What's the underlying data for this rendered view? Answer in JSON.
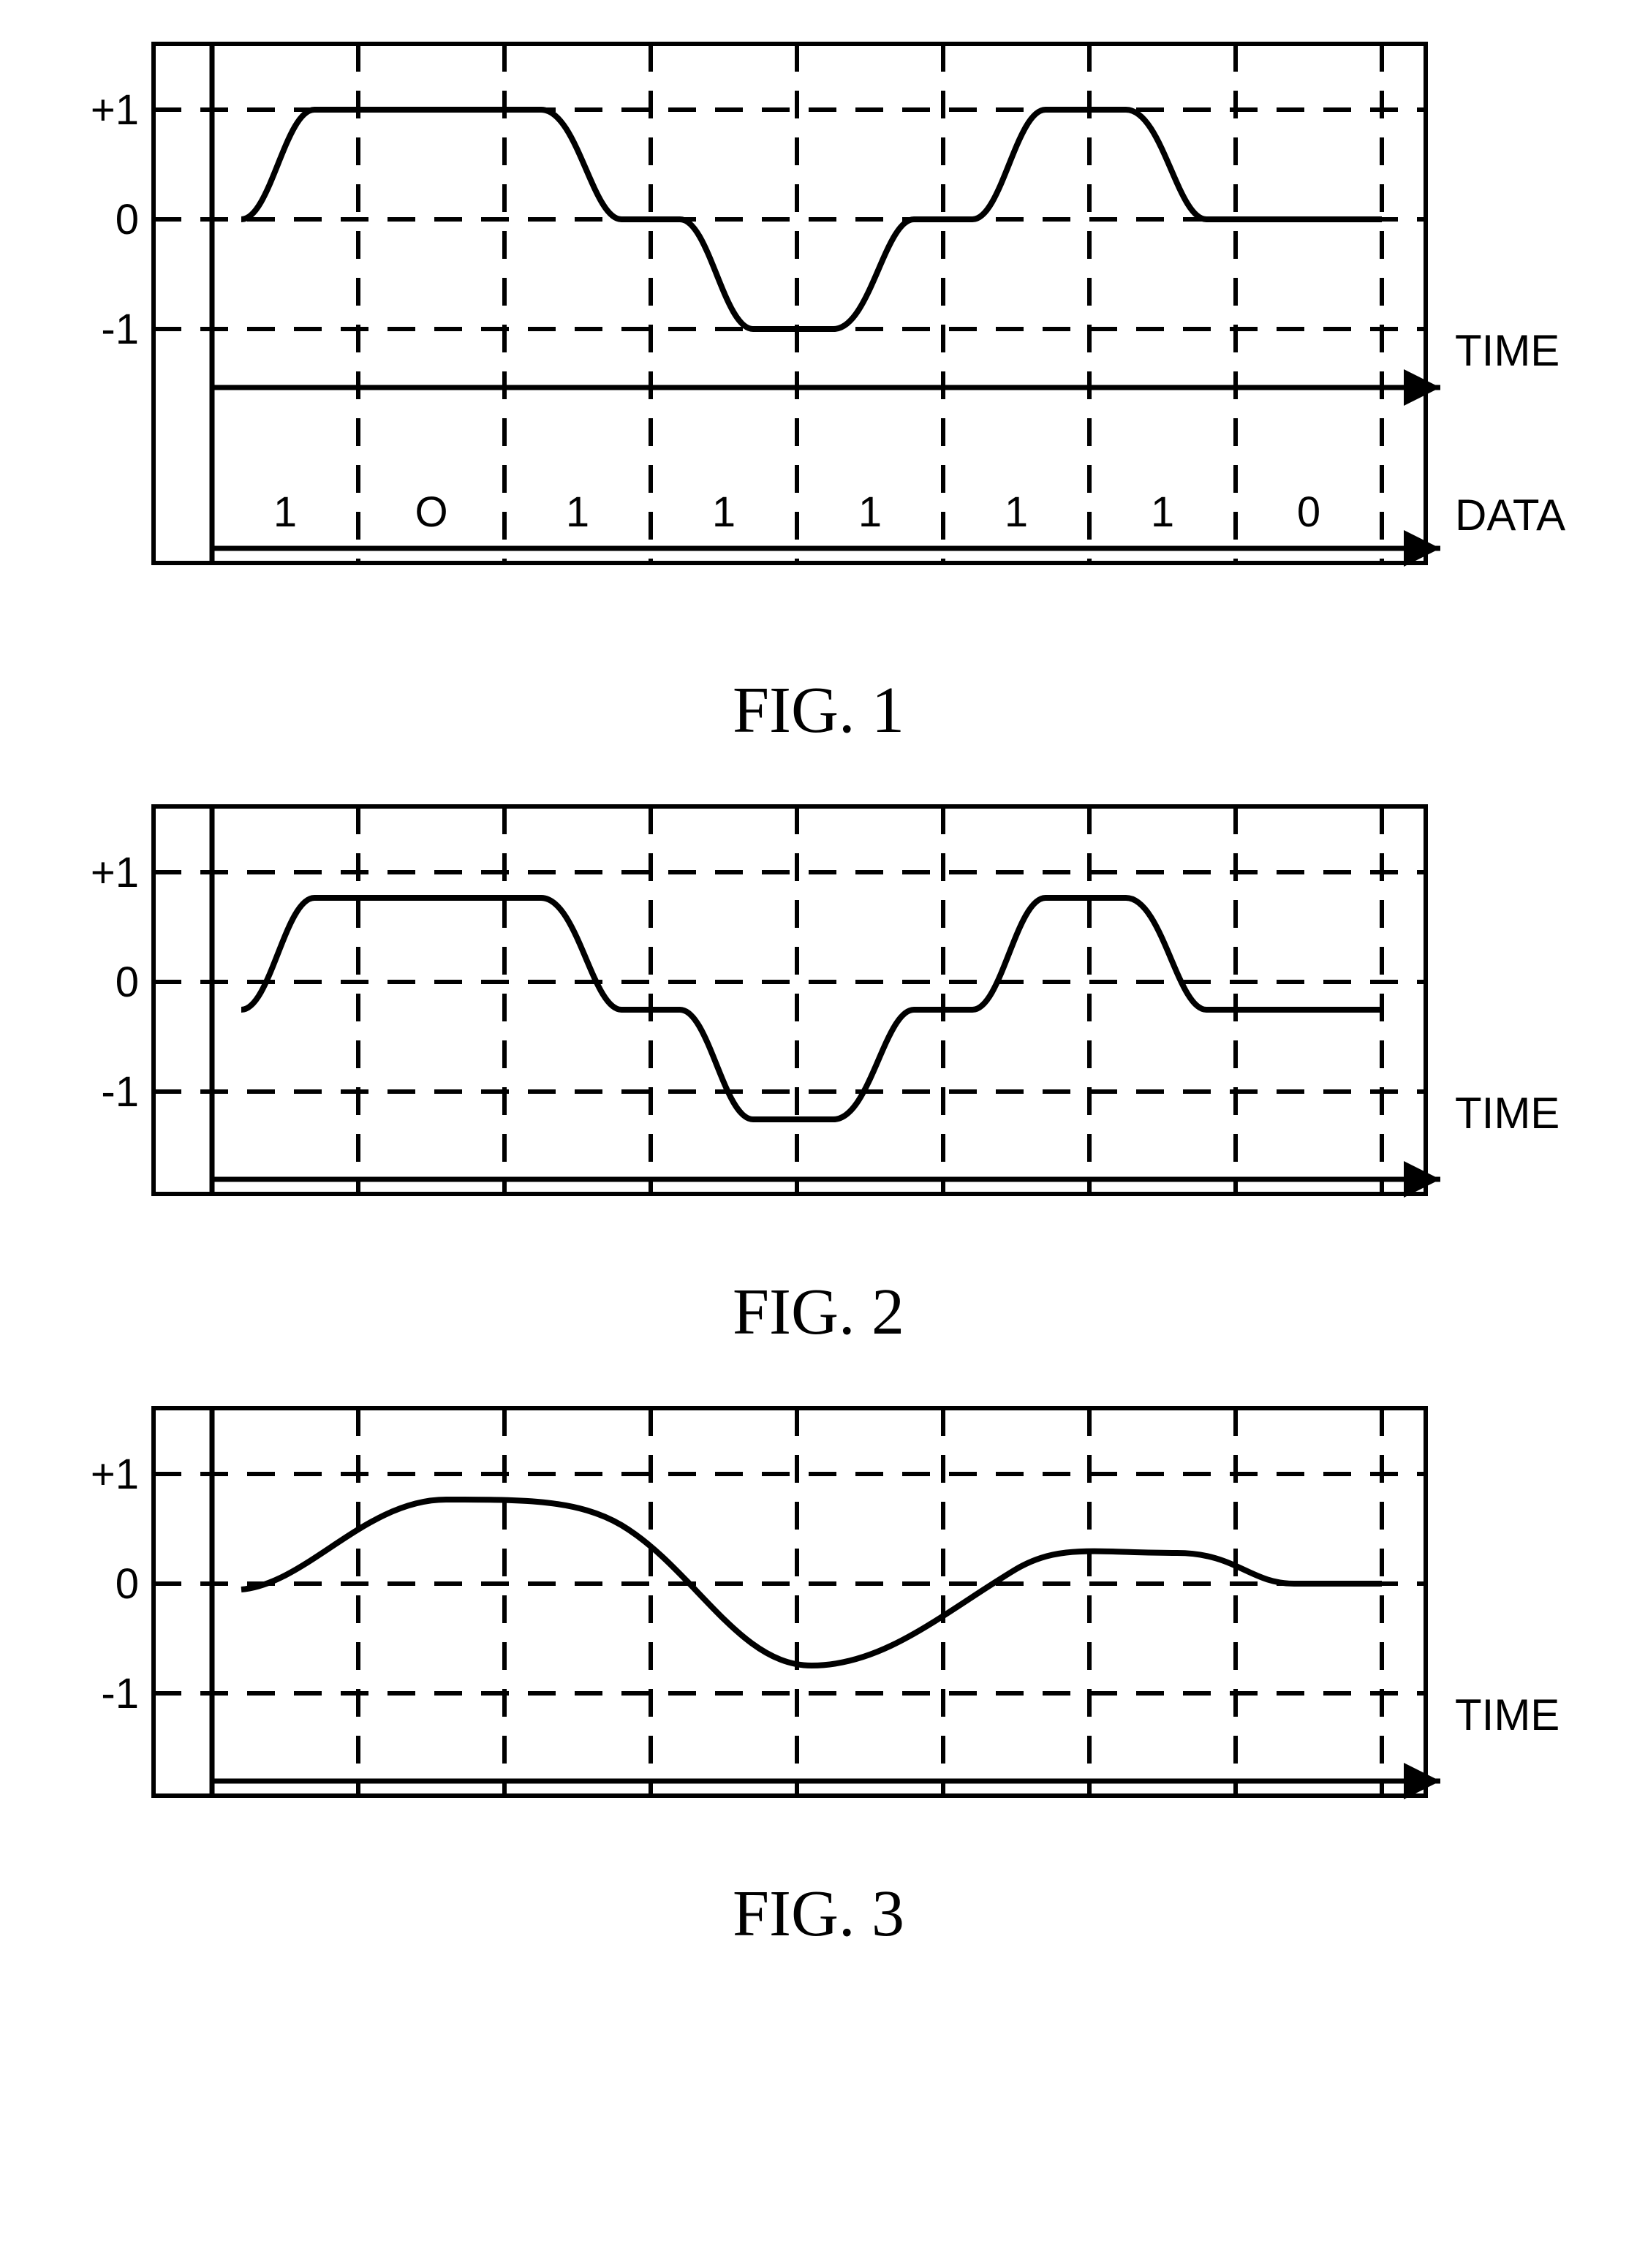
{
  "chart_data": [
    {
      "type": "line",
      "title": "FIG. 1",
      "xlabel": "TIME",
      "ylabel": "",
      "ylim": [
        -1,
        1
      ],
      "y_ticks": [
        "+1",
        "0",
        "-1"
      ],
      "x_axis2_label": "DATA",
      "data_bits": [
        "1",
        "O",
        "1",
        "1",
        "1",
        "1",
        "1",
        "0"
      ],
      "categories": [
        0,
        1,
        2,
        3,
        4,
        5,
        6,
        7,
        8
      ],
      "series": [
        {
          "name": "signal",
          "path_points": [
            [
              0.2,
              0
            ],
            [
              0.7,
              1
            ],
            [
              2.25,
              1
            ],
            [
              2.8,
              0
            ],
            [
              3.2,
              0
            ],
            [
              3.7,
              -1
            ],
            [
              4.25,
              -1
            ],
            [
              4.8,
              0
            ],
            [
              5.2,
              0
            ],
            [
              5.7,
              1
            ],
            [
              6.25,
              1
            ],
            [
              6.8,
              0
            ],
            [
              8.0,
              0
            ]
          ]
        }
      ]
    },
    {
      "type": "line",
      "title": "FIG. 2",
      "xlabel": "TIME",
      "ylabel": "",
      "ylim": [
        -1,
        1
      ],
      "y_ticks": [
        "+1",
        "0",
        "-1"
      ],
      "categories": [
        0,
        1,
        2,
        3,
        4,
        5,
        6,
        7,
        8
      ],
      "series": [
        {
          "name": "signal",
          "path_points": [
            [
              0.2,
              -0.25
            ],
            [
              0.7,
              0.78
            ],
            [
              2.25,
              0.78
            ],
            [
              2.8,
              -0.25
            ],
            [
              3.2,
              -0.25
            ],
            [
              3.7,
              -1.25
            ],
            [
              4.25,
              -1.25
            ],
            [
              4.8,
              -0.25
            ],
            [
              5.2,
              -0.25
            ],
            [
              5.7,
              0.78
            ],
            [
              6.25,
              0.78
            ],
            [
              6.8,
              -0.25
            ],
            [
              8.0,
              -0.25
            ]
          ]
        }
      ]
    },
    {
      "type": "line",
      "title": "FIG. 3",
      "xlabel": "TIME",
      "ylabel": "",
      "ylim": [
        -1,
        1
      ],
      "y_ticks": [
        "+1",
        "0",
        "-1"
      ],
      "categories": [
        0,
        1,
        2,
        3,
        4,
        5,
        6,
        7,
        8
      ],
      "series": [
        {
          "name": "signal",
          "path_points": [
            [
              0.2,
              -0.05
            ],
            [
              1.0,
              0.55
            ],
            [
              1.5,
              0.78
            ],
            [
              2.5,
              0.78
            ],
            [
              3.2,
              0.4
            ],
            [
              4.0,
              -0.6
            ],
            [
              4.4,
              -0.75
            ],
            [
              5.0,
              -0.6
            ],
            [
              5.6,
              0.0
            ],
            [
              6.0,
              0.25
            ],
            [
              6.8,
              0.28
            ],
            [
              7.3,
              0.0
            ],
            [
              8.0,
              0.0
            ]
          ]
        }
      ]
    }
  ]
}
